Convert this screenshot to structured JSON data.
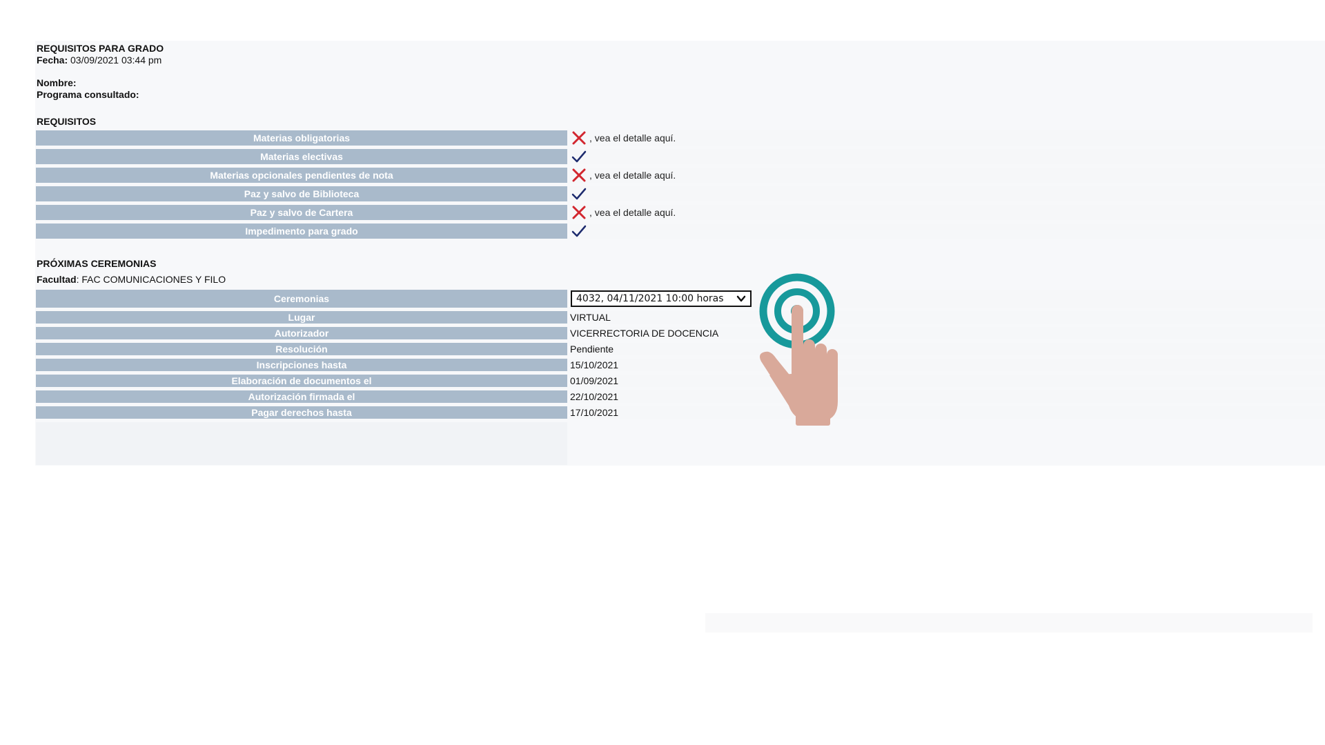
{
  "header": {
    "title": "REQUISITOS PARA GRADO",
    "fecha_label": "Fecha:",
    "fecha_value": "03/09/2021 03:44 pm",
    "nombre_label": "Nombre:",
    "programa_label": "Programa consultado:"
  },
  "requisitos": {
    "heading": "REQUISITOS",
    "detail_text": ", vea el detalle aquí.",
    "rows": [
      {
        "label": "Materias obligatorias",
        "status": "x-icon"
      },
      {
        "label": "Materias electivas",
        "status": "check-icon"
      },
      {
        "label": "Materias opcionales pendientes de nota",
        "status": "x-icon"
      },
      {
        "label": "Paz y salvo de Biblioteca",
        "status": "check-icon"
      },
      {
        "label": "Paz y salvo de Cartera",
        "status": "x-icon"
      },
      {
        "label": "Impedimento para grado",
        "status": "check-icon"
      }
    ]
  },
  "ceremonias": {
    "heading": "PRÓXIMAS CEREMONIAS",
    "facultad_label": "Facultad",
    "facultad_value": ": FAC COMUNICACIONES Y FILO",
    "select_label": "Ceremonias",
    "select_value": "4032, 04/11/2021 10:00 horas",
    "rows": [
      {
        "label": "Lugar",
        "value": "VIRTUAL"
      },
      {
        "label": "Autorizador",
        "value": "VICERRECTORIA DE DOCENCIA"
      },
      {
        "label": "Resolución",
        "value": "Pendiente"
      },
      {
        "label": "Inscripciones hasta",
        "value": "15/10/2021"
      },
      {
        "label": "Elaboración de documentos el",
        "value": "01/09/2021"
      },
      {
        "label": "Autorización firmada el",
        "value": "22/10/2021"
      },
      {
        "label": "Pagar derechos hasta",
        "value": "17/10/2021"
      }
    ]
  },
  "colors": {
    "label_bg": "#a9bacb",
    "x_icon": "#d2262f",
    "check_icon": "#1d2b6e",
    "tap_teal": "#17999b",
    "hand_skin": "#d9a99a"
  },
  "overlay": {
    "icon": "tap-hand-icon"
  }
}
